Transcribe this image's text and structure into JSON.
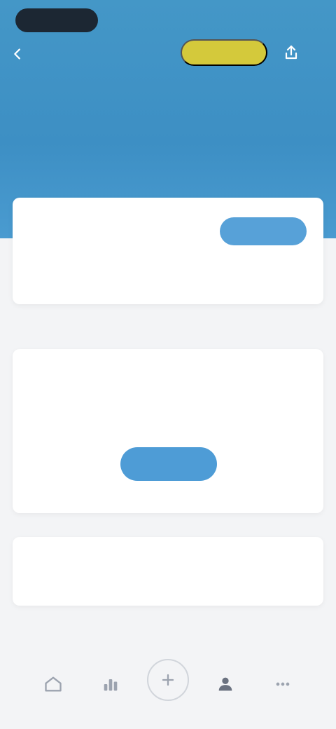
{
  "status_bar": {
    "time": "",
    "indicators": ""
  },
  "header": {
    "back_icon": "chevron-left-icon",
    "badge_label": "",
    "share_icon": "share-icon",
    "title": "",
    "subtitle": "",
    "middle_text": "",
    "accent_color": "#4497c7",
    "badge_color": "#d4c93b"
  },
  "summary": {
    "label": "",
    "value": "",
    "button_label": "",
    "note": ""
  },
  "empty_state": {
    "title": "",
    "description": "",
    "button_label": ""
  },
  "link_card": {
    "text": ""
  },
  "bottom_nav": {
    "items": [
      {
        "icon": "home-icon"
      },
      {
        "icon": "chart-icon"
      },
      {
        "icon": "plus-circle-icon"
      },
      {
        "icon": "user-icon"
      },
      {
        "icon": "more-icon"
      }
    ]
  }
}
